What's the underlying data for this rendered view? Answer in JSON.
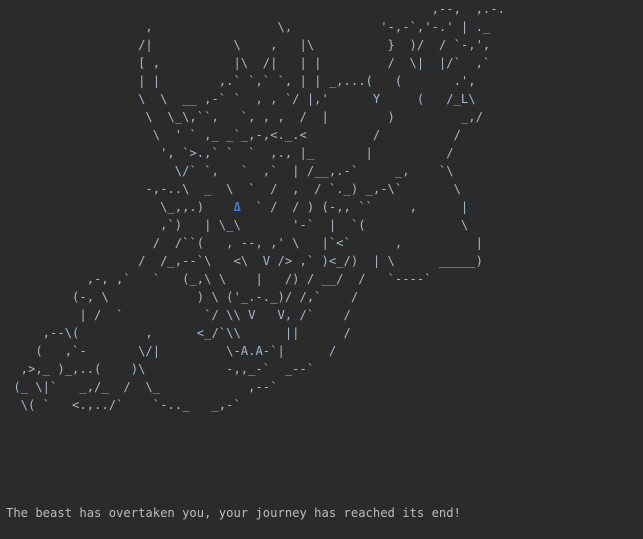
{
  "console": {
    "ascii_art_lines": [
      "                                                          ,--,  ,.-.",
      "                   ,                 \\,            '-,-`,'-.' | ._",
      "                  /|           \\    ,   |\\          }  )/  / `-,',",
      "                  [ ,          |\\  /|   | |         /  \\|  |/`  ,`",
      "                  | |        ,.` `,` `, | | _,...(   (       .',",
      "                  \\  \\  __ ,-` `  , , `/ |,'      Y     (   /_L\\",
      "                   \\  \\_\\,``,   `, , ,  /  |        )         _,/",
      "                    \\  ' ` ,_ _`_,-,<._.<         /          /",
      "                     ', `>.,` `  `  ,., |_       |          /",
      "                       \\/` `,   `  ,`  | /__,.-`     _,    `\\",
      "                   -,-..\\  _  \\  `  /  ,  / `._) _,-\\`       \\",
      "                     \\_,,.)       ` /  / ) (-,, ``     ,      |",
      "                     ,`)   | \\_\\       '-`  |  `(             \\",
      "                    /  /``(   , --, ,' \\   |`<`      ,          |",
      "                  /  /_,--`\\   <\\  V /> ,` )<_/)  | \\      _____)",
      "           ,-, ,`   `   (_,\\ \\    |   /) / __/  /   `----`",
      "         (-, \\            ) \\ ('_.-._)/ /,`    /",
      "          | /  `           `/ \\\\ V   V, /`    /",
      "     ,--\\(         ,      <_/`\\\\      ||      /",
      "    (   ,`-       \\/|         \\-A.A-`|      /",
      "  ,>,_ )_,..(    )\\           -,,_-`  _--`",
      " (_ \\|`   _,/_  /  \\_            ,--`",
      "  \\( `   <.,../`    `-.._   _,-`"
    ],
    "highlight": {
      "line_index": 11,
      "glyph": "Δ",
      "column": 31,
      "color": "#3b7ddb"
    },
    "message": "The beast has overtaken you, your journey has reached its end!"
  },
  "colors": {
    "background": "#2b2b2b",
    "text": "#a9b7c6",
    "message_text": "#bbbbbb",
    "accent": "#3b7ddb"
  }
}
